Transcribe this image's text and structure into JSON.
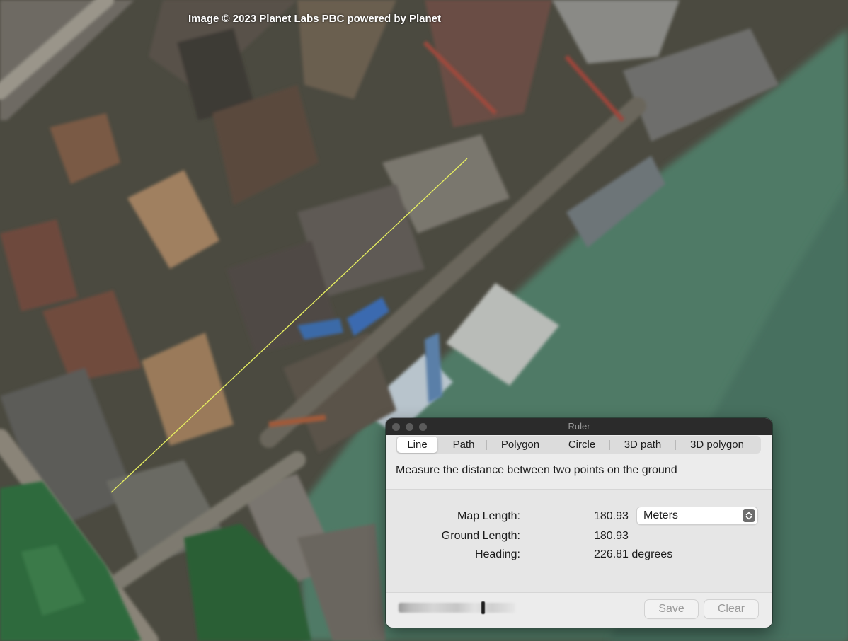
{
  "map": {
    "attribution": "Image © 2023 Planet Labs PBC powered by Planet",
    "measure_line_color": "#e8f060"
  },
  "ruler": {
    "title": "Ruler",
    "tabs": [
      {
        "label": "Line",
        "active": true
      },
      {
        "label": "Path",
        "active": false
      },
      {
        "label": "Polygon",
        "active": false
      },
      {
        "label": "Circle",
        "active": false
      },
      {
        "label": "3D path",
        "active": false
      },
      {
        "label": "3D polygon",
        "active": false
      }
    ],
    "description": "Measure the distance between two points on the ground",
    "map_length_label": "Map Length:",
    "map_length_value": "180.93",
    "units_selected": "Meters",
    "ground_length_label": "Ground Length:",
    "ground_length_value": "180.93",
    "heading_label": "Heading:",
    "heading_value": "226.81 degrees",
    "save_label": "Save",
    "clear_label": "Clear",
    "stepper_icon": "up-down-chevron-icon"
  }
}
